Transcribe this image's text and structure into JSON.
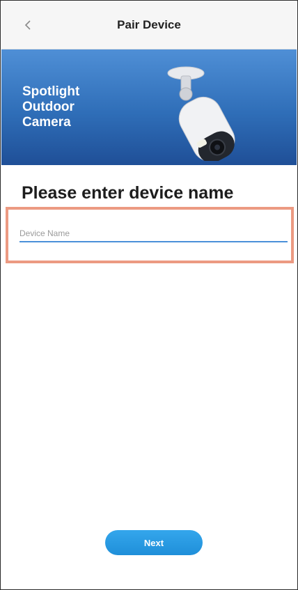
{
  "header": {
    "title": "Pair Device",
    "back_icon": "chevron-left-icon"
  },
  "banner": {
    "title_lines": [
      "Spotlight",
      "Outdoor",
      "Camera"
    ],
    "image": "security-camera-icon"
  },
  "main": {
    "heading": "Please enter device name",
    "device_name_input": {
      "value": "",
      "placeholder": "Device Name"
    }
  },
  "footer": {
    "next_label": "Next"
  },
  "colors": {
    "accent": "#1f8fd9",
    "banner_top": "#4f8fd6",
    "banner_bottom": "#1f4f97",
    "highlight_border": "#ec9a82",
    "input_underline": "#4a90d9"
  }
}
